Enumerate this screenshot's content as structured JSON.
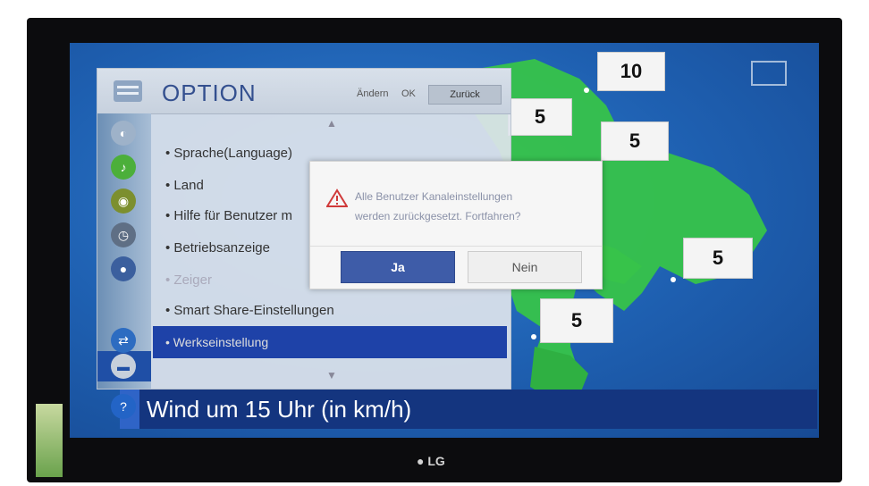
{
  "option_menu": {
    "title": "OPTION",
    "header_hint_left": "Ändern",
    "header_hint_right": "OK",
    "header_button": "Zurück",
    "items": [
      {
        "label": "• Sprache(Language)"
      },
      {
        "label": "• Land"
      },
      {
        "label": "• Hilfe für Benutzer m"
      },
      {
        "label": "• Betriebsanzeige"
      },
      {
        "label": "• Zeiger"
      },
      {
        "label": "• Smart Share-Einstellungen"
      }
    ],
    "selected_item": "• Werkseinstellung"
  },
  "dialog": {
    "message_line1": "Alle Benutzer Kanaleinstellungen",
    "message_line2": "werden zurückgesetzt. Fortfahren?",
    "yes_label": "Ja",
    "no_label": "Nein"
  },
  "weather": {
    "banner": "Wind um 15 Uhr (in km/h)",
    "wind_values": [
      "10",
      "5",
      "5",
      "5",
      "5"
    ]
  },
  "tv": {
    "brand": "LG"
  },
  "colors": {
    "sea": "#1e5fb0",
    "land": "#37c34a",
    "banner": "#14357f",
    "selection": "#1e42a8",
    "yes_button": "#3e5ca8"
  },
  "icons": {
    "dialog": "warning-triangle-icon",
    "scroll_up": "chevron-up-icon",
    "scroll_down": "chevron-down-icon"
  }
}
